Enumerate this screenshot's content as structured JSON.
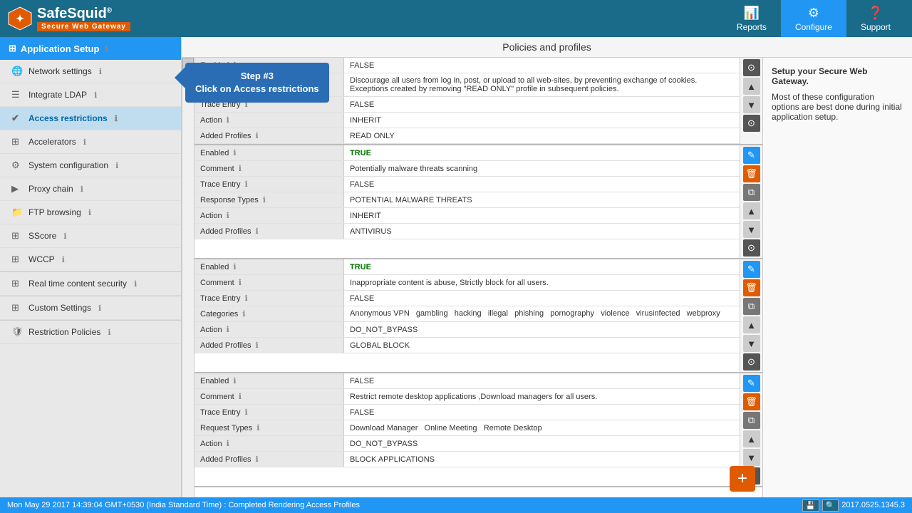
{
  "header": {
    "logo_name": "SafeSquid",
    "logo_sup": "®",
    "logo_tagline": "Secure Web Gateway",
    "nav": [
      {
        "label": "Reports",
        "icon": "📊",
        "active": false
      },
      {
        "label": "Configure",
        "icon": "⚙",
        "active": true
      },
      {
        "label": "Support",
        "icon": "❓",
        "active": false
      }
    ]
  },
  "sidebar": {
    "section_label": "Application Setup",
    "items": [
      {
        "label": "Network settings",
        "icon": "🌐",
        "help": true,
        "active": false
      },
      {
        "label": "Integrate LDAP",
        "icon": "☰",
        "help": true,
        "active": false
      },
      {
        "label": "Access restrictions",
        "icon": "✔",
        "help": true,
        "active": true
      },
      {
        "label": "Accelerators",
        "icon": "⊞",
        "help": true,
        "active": false
      },
      {
        "label": "System configuration",
        "icon": "⊞",
        "help": true,
        "active": false
      },
      {
        "label": "Proxy chain",
        "icon": "▶▶",
        "help": true,
        "active": false
      },
      {
        "label": "FTP browsing",
        "icon": "⊞",
        "help": true,
        "active": false
      },
      {
        "label": "SScore",
        "icon": "⊞",
        "help": true,
        "active": false
      },
      {
        "label": "WCCP",
        "icon": "⊞",
        "help": true,
        "active": false
      },
      {
        "label": "Real time content security",
        "icon": "⊞",
        "help": true,
        "active": false
      },
      {
        "label": "Custom Settings",
        "icon": "⊞",
        "help": true,
        "active": false
      },
      {
        "label": "Restriction Policies",
        "icon": "⊞",
        "help": true,
        "active": false
      }
    ]
  },
  "content": {
    "header": "Policies and profiles",
    "tooltip": {
      "line1": "Step #3",
      "line2": "Click on Access restrictions"
    },
    "policies": [
      {
        "fields": [
          {
            "label": "Enabled",
            "value": "FALSE"
          },
          {
            "label": "Comment",
            "value": "Discourage all users from log in, post, or upload to all web-sites, by preventing exchange of cookies.\nExceptions created by removing \"READ ONLY\" profile in subsequent policies."
          },
          {
            "label": "Trace Entry",
            "value": "FALSE"
          },
          {
            "label": "Action",
            "value": "INHERIT"
          },
          {
            "label": "Added Profiles",
            "value": "READ ONLY"
          }
        ]
      },
      {
        "fields": [
          {
            "label": "Enabled",
            "value": "TRUE"
          },
          {
            "label": "Comment",
            "value": "Potentially malware threats scanning"
          },
          {
            "label": "Trace Entry",
            "value": "FALSE"
          },
          {
            "label": "Response Types",
            "value": "POTENTIAL MALWARE THREATS"
          },
          {
            "label": "Action",
            "value": "INHERIT"
          },
          {
            "label": "Added Profiles",
            "value": "ANTIVIRUS"
          }
        ]
      },
      {
        "fields": [
          {
            "label": "Enabled",
            "value": "TRUE"
          },
          {
            "label": "Comment",
            "value": "Inappropriate content is abuse, Strictly block for all users."
          },
          {
            "label": "Trace Entry",
            "value": "FALSE"
          },
          {
            "label": "Categories",
            "value": "Anonymous VPN  gambling  hacking  illegal  phishing  pornography  violence  virusinfected  webproxy"
          },
          {
            "label": "Action",
            "value": "DO_NOT_BYPASS"
          },
          {
            "label": "Added Profiles",
            "value": "GLOBAL BLOCK"
          }
        ]
      },
      {
        "fields": [
          {
            "label": "Enabled",
            "value": "FALSE"
          },
          {
            "label": "Comment",
            "value": "Restrict remote desktop applications ,Download managers for all users."
          },
          {
            "label": "Trace Entry",
            "value": "FALSE"
          },
          {
            "label": "Request Types",
            "value": "Download Manager  Online Meeting  Remote Desktop"
          },
          {
            "label": "Action",
            "value": "DO_NOT_BYPASS"
          },
          {
            "label": "Added Profiles",
            "value": "BLOCK APPLICATIONS"
          }
        ]
      }
    ]
  },
  "right_panel": {
    "title": "Setup your Secure Web Gateway.",
    "body": "Most of these configuration options are best done during initial application setup."
  },
  "bottom_bar": {
    "status": "Mon May 29 2017 14:39:04 GMT+0530 (India Standard Time) : Completed Rendering Access Profiles",
    "version": "2017.0525.1345.3"
  },
  "fab": "+"
}
